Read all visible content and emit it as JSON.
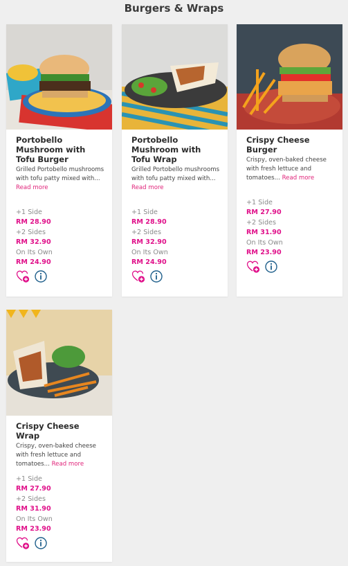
{
  "section": {
    "title": "Burgers & Wraps"
  },
  "read_more_label": "Read more",
  "icons": {
    "favourite": "heart-plus-icon",
    "info": "info-icon"
  },
  "colors": {
    "accent": "#e0118a",
    "background": "#efefef",
    "card": "#ffffff"
  },
  "products": [
    {
      "name": "Portobello Mushroom with Tofu Burger",
      "desc": "Grilled Portobello mushrooms with tofu patty mixed with...",
      "options": [
        {
          "label": "+1 Side",
          "price": "RM 28.90"
        },
        {
          "label": "+2 Sides",
          "price": "RM 32.90"
        },
        {
          "label": "On Its Own",
          "price": "RM 24.90"
        }
      ]
    },
    {
      "name": "Portobello Mushroom with Tofu Wrap",
      "desc": "Grilled Portobello mushrooms with tofu patty mixed with...",
      "options": [
        {
          "label": "+1 Side",
          "price": "RM 28.90"
        },
        {
          "label": "+2 Sides",
          "price": "RM 32.90"
        },
        {
          "label": "On Its Own",
          "price": "RM 24.90"
        }
      ]
    },
    {
      "name": "Crispy Cheese Burger",
      "desc": "Crispy, oven-baked cheese with fresh lettuce and tomatoes...",
      "options": [
        {
          "label": "+1 Side",
          "price": "RM 27.90"
        },
        {
          "label": "+2 Sides",
          "price": "RM 31.90"
        },
        {
          "label": "On Its Own",
          "price": "RM 23.90"
        }
      ]
    },
    {
      "name": "Crispy Cheese Wrap",
      "desc": "Crispy, oven-baked cheese with fresh lettuce and tomatoes...",
      "options": [
        {
          "label": "+1 Side",
          "price": "RM 27.90"
        },
        {
          "label": "+2 Sides",
          "price": "RM 31.90"
        },
        {
          "label": "On Its Own",
          "price": "RM 23.90"
        }
      ]
    }
  ]
}
